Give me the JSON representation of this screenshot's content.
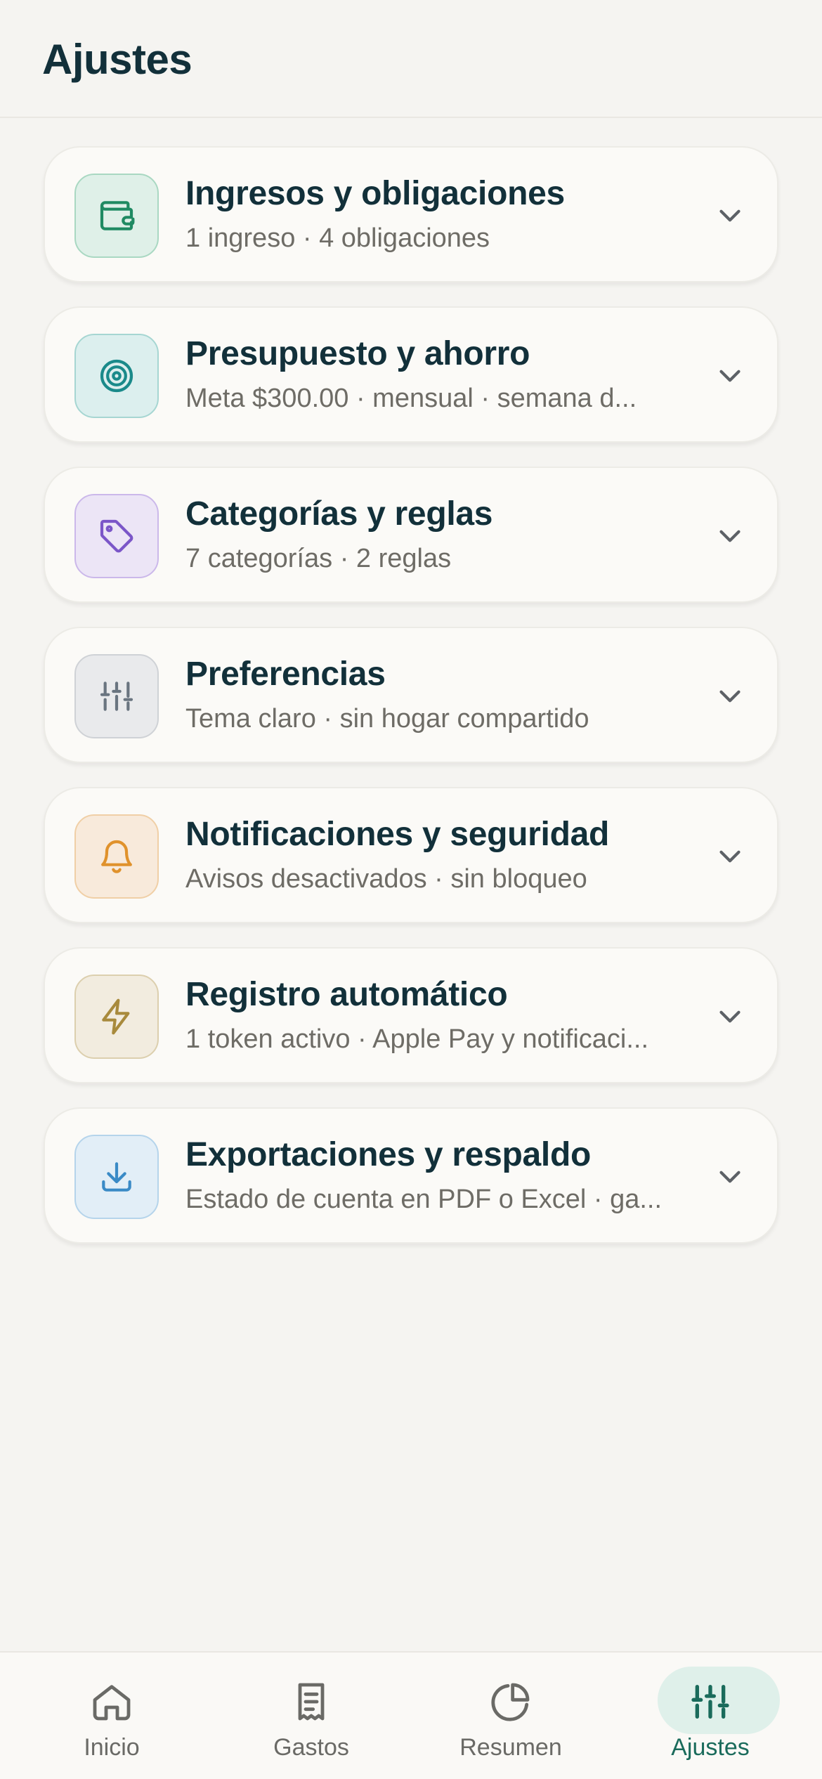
{
  "header": {
    "title": "Ajustes"
  },
  "cards": [
    {
      "title": "Ingresos y obligaciones",
      "subtitle": "1 ingreso · 4 obligaciones",
      "icon": "wallet-icon",
      "color": "#1f8a62",
      "bg": "#dff0e8",
      "border": "#a9d8c2"
    },
    {
      "title": "Presupuesto y ahorro",
      "subtitle": "Meta $300.00 · mensual · semana d...",
      "icon": "target-icon",
      "color": "#1a8a8a",
      "bg": "#dcefee",
      "border": "#a6d6d2"
    },
    {
      "title": "Categorías y reglas",
      "subtitle": "7 categorías · 2 reglas",
      "icon": "tag-icon",
      "color": "#7b56c8",
      "bg": "#ece5f6",
      "border": "#cbb8ea"
    },
    {
      "title": "Preferencias",
      "subtitle": "Tema claro · sin hogar compartido",
      "icon": "sliders-icon",
      "color": "#6a7580",
      "bg": "#e9eaec",
      "border": "#cfd2d6"
    },
    {
      "title": "Notificaciones y seguridad",
      "subtitle": "Avisos desactivados · sin bloqueo",
      "icon": "bell-icon",
      "color": "#e0922c",
      "bg": "#f8eadb",
      "border": "#f0cfa6"
    },
    {
      "title": "Registro automático",
      "subtitle": "1 token activo · Apple Pay y notificaci...",
      "icon": "bolt-icon",
      "color": "#a88a3c",
      "bg": "#f2ecdf",
      "border": "#dccfae"
    },
    {
      "title": "Exportaciones y respaldo",
      "subtitle": "Estado de cuenta en PDF o Excel · ga...",
      "icon": "download-icon",
      "color": "#3a8ac6",
      "bg": "#e2eef7",
      "border": "#b5d4eb"
    }
  ],
  "nav": [
    {
      "label": "Inicio",
      "icon": "home-icon",
      "active": false
    },
    {
      "label": "Gastos",
      "icon": "receipt-icon",
      "active": false
    },
    {
      "label": "Resumen",
      "icon": "pie-chart-icon",
      "active": false
    },
    {
      "label": "Ajustes",
      "icon": "sliders-icon",
      "active": true
    }
  ],
  "colors": {
    "accent": "#1a6b5b",
    "accent_bg": "#dff0ea",
    "text": "#12303a",
    "muted": "#6e6c66"
  }
}
